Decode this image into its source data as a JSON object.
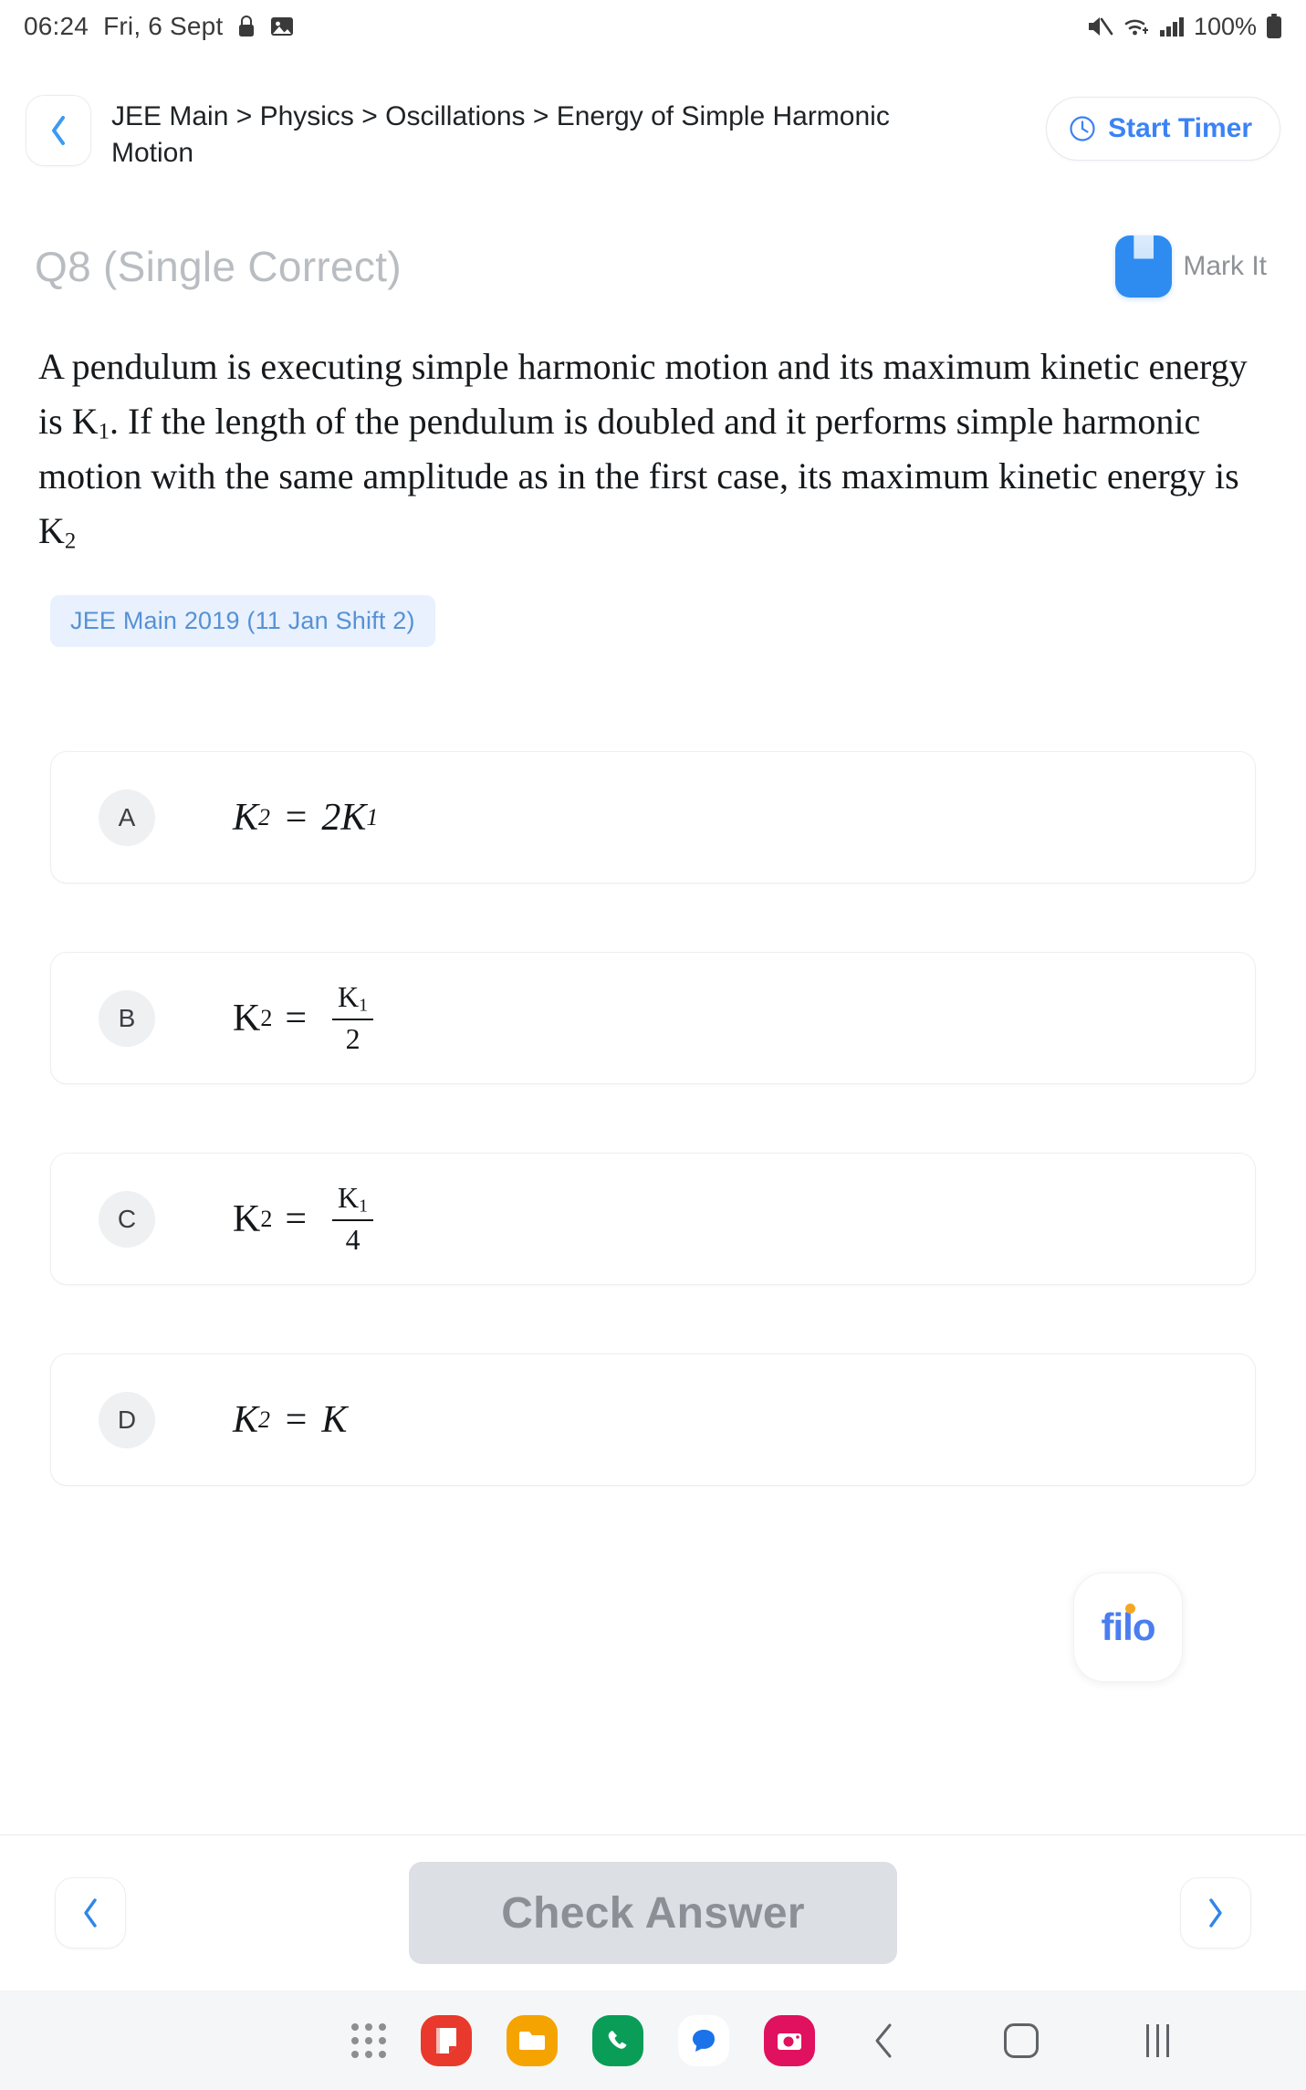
{
  "status_bar": {
    "time": "06:24",
    "date": "Fri, 6 Sept",
    "battery": "100%",
    "left_icons": [
      "lock-icon",
      "image-icon"
    ],
    "right_icons": [
      "mute-icon",
      "wifi-icon",
      "signal-icon",
      "battery-icon"
    ]
  },
  "header": {
    "back_label": "‹",
    "breadcrumb": "JEE Main > Physics > Oscillations > Energy of Simple Harmonic Motion",
    "timer_label": "Start Timer",
    "timer_icon": "clock-icon",
    "accent_color": "#3b82f6"
  },
  "question": {
    "title": "Q8 (Single Correct)",
    "mark_label": "Mark It",
    "mark_icon": "bookmark-icon",
    "mark_icon_color": "#2e8bf0",
    "text_part1": "A pendulum is executing simple harmonic motion and its maximum kinetic energy is ",
    "var_k1": "K",
    "var_k1_sub": "1",
    "text_part2": ". If the length of the pendulum is doubled and it performs simple harmonic motion with the same amplitude as in the first case, its maximum kinetic energy is ",
    "var_k2": "K",
    "var_k2_sub": "2",
    "tag": "JEE Main 2019 (11 Jan Shift 2)",
    "tag_bg": "#e8f1fd",
    "tag_color": "#5691d6"
  },
  "options": [
    {
      "badge": "A",
      "lhs": "K",
      "lhs_sub": "2",
      "eq": "=",
      "rhs_type": "plain",
      "rhs": "2K",
      "rhs_sub": "1",
      "style": "italic"
    },
    {
      "badge": "B",
      "lhs": "K",
      "lhs_sub": "2",
      "eq": "=",
      "rhs_type": "fraction",
      "num": "K",
      "num_sub": "1",
      "den": "2",
      "style": "upright"
    },
    {
      "badge": "C",
      "lhs": "K",
      "lhs_sub": "2",
      "eq": "=",
      "rhs_type": "fraction",
      "num": "K",
      "num_sub": "1",
      "den": "4",
      "style": "upright"
    },
    {
      "badge": "D",
      "lhs": "K",
      "lhs_sub": "2",
      "eq": "=",
      "rhs_type": "plain",
      "rhs": "K",
      "rhs_sub": "",
      "style": "italic"
    }
  ],
  "brand": {
    "name": "filo",
    "text_color": "#4a7ef0",
    "dot_color": "#f6a623"
  },
  "action_bar": {
    "prev_label": "‹",
    "next_label": "›",
    "check_label": "Check Answer",
    "check_disabled_bg": "#dcdfe4",
    "check_disabled_color": "#8b9097"
  },
  "android_nav": {
    "apps_icon": "apps-grid-icon",
    "app_icons": [
      {
        "name": "notes-icon",
        "color": "#e8392c"
      },
      {
        "name": "files-icon",
        "color": "#f5a300"
      },
      {
        "name": "phone-icon",
        "color": "#0a9d58"
      },
      {
        "name": "messages-icon",
        "color": "#ffffff"
      },
      {
        "name": "camera-icon",
        "color": "#e0115f"
      }
    ],
    "system": [
      "back-icon",
      "home-icon",
      "recents-icon"
    ]
  }
}
